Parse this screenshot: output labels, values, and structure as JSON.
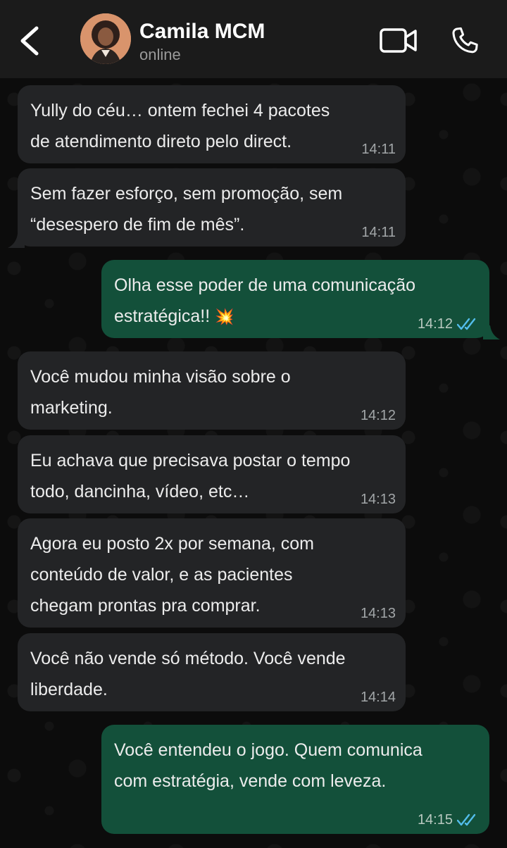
{
  "header": {
    "contact_name": "Camila MCM",
    "status": "online"
  },
  "colors": {
    "header_bg": "#1b1b1b",
    "incoming_bubble": "#232426",
    "outgoing_bubble": "#13503a",
    "read_ticks": "#53bdeb"
  },
  "icons": [
    "back-arrow-icon",
    "video-camera-icon",
    "phone-icon",
    "double-check-icon",
    "sparkle-emoji"
  ],
  "messages": [
    {
      "direction": "in",
      "text": "Yully do céu… ontem fechei 4 pacotes\nde atendimento direto pelo direct.",
      "time": "14:11"
    },
    {
      "direction": "in",
      "text": "Sem fazer esforço, sem promoção, sem\n“desespero de fim de mês”.",
      "time": "14:11"
    },
    {
      "direction": "out",
      "text": "Olha esse poder de uma comunicação\nestratégica!!",
      "emoji": "💥",
      "time": "14:12",
      "read": true
    },
    {
      "direction": "in",
      "text": "Você mudou minha visão sobre o\nmarketing.",
      "time": "14:12"
    },
    {
      "direction": "in",
      "text": "Eu achava que precisava postar o tempo\ntodo, dancinha, vídeo, etc…",
      "time": "14:13"
    },
    {
      "direction": "in",
      "text": "Agora eu posto 2x por semana, com\nconteúdo de valor, e as pacientes\nchegam prontas pra comprar.",
      "time": "14:13"
    },
    {
      "direction": "in",
      "text": "Você não vende só método. Você vende\nliberdade.",
      "time": "14:14"
    },
    {
      "direction": "out",
      "text": "Você entendeu o jogo. Quem comunica\ncom estratégia, vende com leveza.",
      "time": "14:15",
      "read": true
    }
  ]
}
